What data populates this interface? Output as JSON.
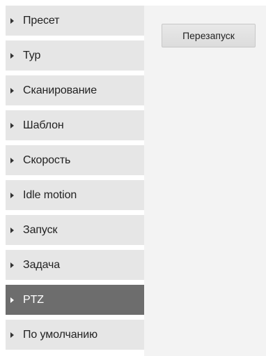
{
  "sidebar": {
    "items": [
      {
        "label": "Пресет",
        "active": false
      },
      {
        "label": "Тур",
        "active": false
      },
      {
        "label": "Сканирование",
        "active": false
      },
      {
        "label": "Шаблон",
        "active": false
      },
      {
        "label": "Скорость",
        "active": false
      },
      {
        "label": "Idle motion",
        "active": false
      },
      {
        "label": "Запуск",
        "active": false
      },
      {
        "label": "Задача",
        "active": false
      },
      {
        "label": "PTZ",
        "active": true
      },
      {
        "label": "По умолчанию",
        "active": false
      }
    ]
  },
  "main": {
    "restart_label": "Перезапуск"
  },
  "colors": {
    "item_bg": "#e6e6e6",
    "item_active_bg": "#6d6d6d",
    "content_bg": "#f3f3f3"
  }
}
